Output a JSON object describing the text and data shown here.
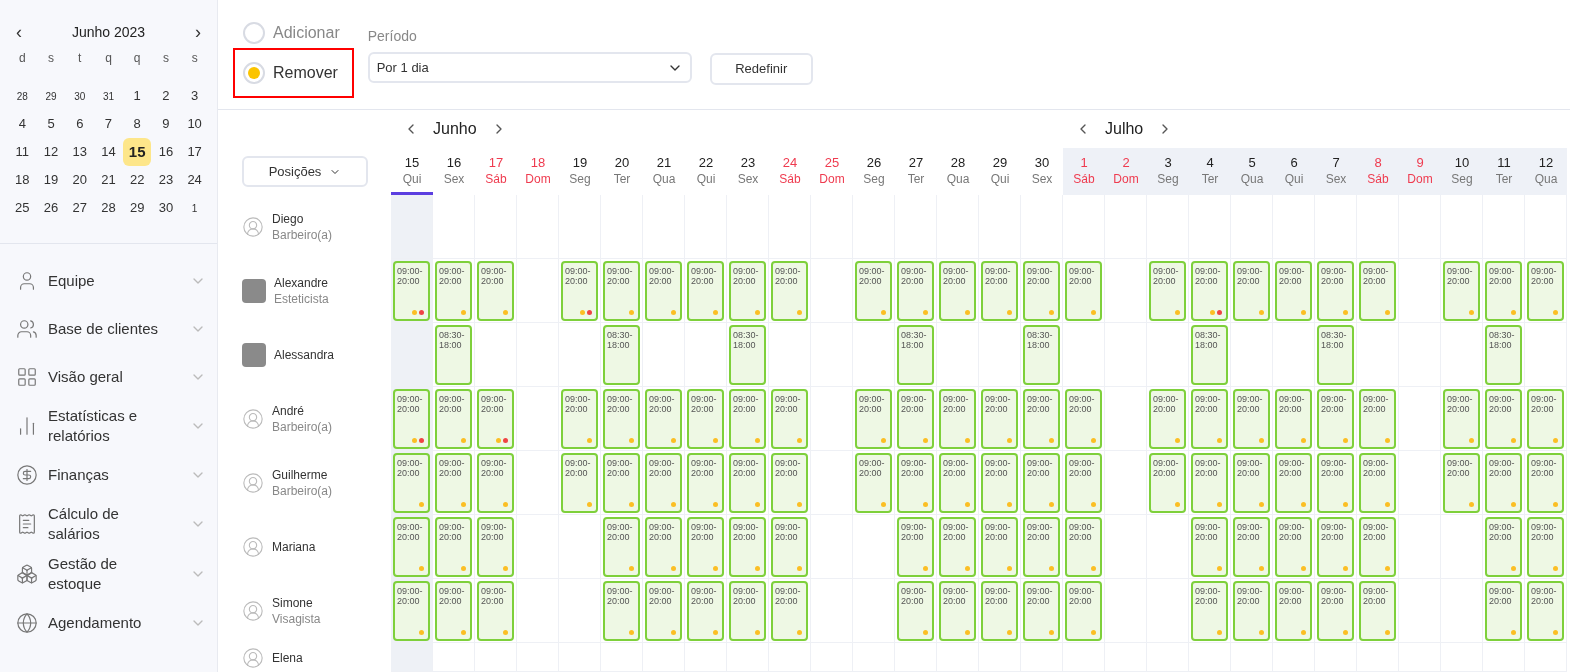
{
  "calendar": {
    "title": "Junho 2023",
    "prev": "‹",
    "next": "›",
    "weekdays": [
      "d",
      "s",
      "t",
      "q",
      "q",
      "s",
      "s"
    ],
    "days": [
      {
        "label": "28",
        "outside": true,
        "selected": false
      },
      {
        "label": "29",
        "outside": true,
        "selected": false
      },
      {
        "label": "30",
        "outside": true,
        "selected": false
      },
      {
        "label": "31",
        "outside": true,
        "selected": false
      },
      {
        "label": "1",
        "outside": false,
        "selected": false
      },
      {
        "label": "2",
        "outside": false,
        "selected": false
      },
      {
        "label": "3",
        "outside": false,
        "selected": false
      },
      {
        "label": "4",
        "outside": false,
        "selected": false
      },
      {
        "label": "5",
        "outside": false,
        "selected": false
      },
      {
        "label": "6",
        "outside": false,
        "selected": false
      },
      {
        "label": "7",
        "outside": false,
        "selected": false
      },
      {
        "label": "8",
        "outside": false,
        "selected": false
      },
      {
        "label": "9",
        "outside": false,
        "selected": false
      },
      {
        "label": "10",
        "outside": false,
        "selected": false
      },
      {
        "label": "11",
        "outside": false,
        "selected": false
      },
      {
        "label": "12",
        "outside": false,
        "selected": false
      },
      {
        "label": "13",
        "outside": false,
        "selected": false
      },
      {
        "label": "14",
        "outside": false,
        "selected": false
      },
      {
        "label": "15",
        "outside": false,
        "selected": true
      },
      {
        "label": "16",
        "outside": false,
        "selected": false
      },
      {
        "label": "17",
        "outside": false,
        "selected": false
      },
      {
        "label": "18",
        "outside": false,
        "selected": false
      },
      {
        "label": "19",
        "outside": false,
        "selected": false
      },
      {
        "label": "20",
        "outside": false,
        "selected": false
      },
      {
        "label": "21",
        "outside": false,
        "selected": false
      },
      {
        "label": "22",
        "outside": false,
        "selected": false
      },
      {
        "label": "23",
        "outside": false,
        "selected": false
      },
      {
        "label": "24",
        "outside": false,
        "selected": false
      },
      {
        "label": "25",
        "outside": false,
        "selected": false
      },
      {
        "label": "26",
        "outside": false,
        "selected": false
      },
      {
        "label": "27",
        "outside": false,
        "selected": false
      },
      {
        "label": "28",
        "outside": false,
        "selected": false
      },
      {
        "label": "29",
        "outside": false,
        "selected": false
      },
      {
        "label": "30",
        "outside": false,
        "selected": false
      },
      {
        "label": "1",
        "outside": true,
        "selected": false
      }
    ]
  },
  "nav": [
    {
      "label": "Equipe"
    },
    {
      "label": "Base de clientes"
    },
    {
      "label": "Visão geral"
    },
    {
      "label": "Estatísticas e relatórios"
    },
    {
      "label": "Finanças"
    },
    {
      "label": "Cálculo de salários"
    },
    {
      "label": "Gestão de estoque"
    },
    {
      "label": "Agendamento"
    }
  ],
  "mode": [
    {
      "label": "Adicionar",
      "selected": false,
      "highlighted": false
    },
    {
      "label": "Remover",
      "selected": true,
      "highlighted": true
    }
  ],
  "period": {
    "label": "Período",
    "value": "Por 1 dia"
  },
  "reset_button": "Redefinir",
  "positions_button": "Posições",
  "months": [
    {
      "name": "Junho",
      "shaded": false,
      "days": [
        {
          "date": "15",
          "weekday": "Qui",
          "weekend": false,
          "selected": true
        },
        {
          "date": "16",
          "weekday": "Sex",
          "weekend": false,
          "selected": false
        },
        {
          "date": "17",
          "weekday": "Sáb",
          "weekend": true,
          "selected": false
        },
        {
          "date": "18",
          "weekday": "Dom",
          "weekend": true,
          "selected": false
        },
        {
          "date": "19",
          "weekday": "Seg",
          "weekend": false,
          "selected": false
        },
        {
          "date": "20",
          "weekday": "Ter",
          "weekend": false,
          "selected": false
        },
        {
          "date": "21",
          "weekday": "Qua",
          "weekend": false,
          "selected": false
        },
        {
          "date": "22",
          "weekday": "Qui",
          "weekend": false,
          "selected": false
        },
        {
          "date": "23",
          "weekday": "Sex",
          "weekend": false,
          "selected": false
        },
        {
          "date": "24",
          "weekday": "Sáb",
          "weekend": true,
          "selected": false
        },
        {
          "date": "25",
          "weekday": "Dom",
          "weekend": true,
          "selected": false
        },
        {
          "date": "26",
          "weekday": "Seg",
          "weekend": false,
          "selected": false
        },
        {
          "date": "27",
          "weekday": "Ter",
          "weekend": false,
          "selected": false
        },
        {
          "date": "28",
          "weekday": "Qua",
          "weekend": false,
          "selected": false
        },
        {
          "date": "29",
          "weekday": "Qui",
          "weekend": false,
          "selected": false
        },
        {
          "date": "30",
          "weekday": "Sex",
          "weekend": false,
          "selected": false
        }
      ]
    },
    {
      "name": "Julho",
      "shaded": true,
      "days": [
        {
          "date": "1",
          "weekday": "Sáb",
          "weekend": true,
          "selected": false
        },
        {
          "date": "2",
          "weekday": "Dom",
          "weekend": true,
          "selected": false
        },
        {
          "date": "3",
          "weekday": "Seg",
          "weekend": false,
          "selected": false
        },
        {
          "date": "4",
          "weekday": "Ter",
          "weekend": false,
          "selected": false
        },
        {
          "date": "5",
          "weekday": "Qua",
          "weekend": false,
          "selected": false
        },
        {
          "date": "6",
          "weekday": "Qui",
          "weekend": false,
          "selected": false
        },
        {
          "date": "7",
          "weekday": "Sex",
          "weekend": false,
          "selected": false
        },
        {
          "date": "8",
          "weekday": "Sáb",
          "weekend": true,
          "selected": false
        },
        {
          "date": "9",
          "weekday": "Dom",
          "weekend": true,
          "selected": false
        },
        {
          "date": "10",
          "weekday": "Seg",
          "weekend": false,
          "selected": false
        },
        {
          "date": "11",
          "weekday": "Ter",
          "weekend": false,
          "selected": false
        },
        {
          "date": "12",
          "weekday": "Qua",
          "weekend": false,
          "selected": false
        }
      ]
    }
  ],
  "staff": [
    {
      "name": "Diego",
      "role": "Barbeiro(a)",
      "kind": "generic",
      "cells": [
        {
          "kind": "empty"
        },
        {
          "kind": "empty"
        },
        {
          "kind": "empty"
        },
        {
          "kind": "empty"
        },
        {
          "kind": "empty"
        },
        {
          "kind": "empty"
        },
        {
          "kind": "empty"
        },
        {
          "kind": "empty"
        },
        {
          "kind": "empty"
        },
        {
          "kind": "empty"
        },
        {
          "kind": "empty"
        },
        {
          "kind": "empty"
        },
        {
          "kind": "empty"
        },
        {
          "kind": "empty"
        },
        {
          "kind": "empty"
        },
        {
          "kind": "empty"
        },
        {
          "kind": "empty"
        },
        {
          "kind": "empty"
        },
        {
          "kind": "empty"
        },
        {
          "kind": "empty"
        },
        {
          "kind": "empty"
        },
        {
          "kind": "empty"
        },
        {
          "kind": "empty"
        },
        {
          "kind": "empty"
        },
        {
          "kind": "empty"
        },
        {
          "kind": "empty"
        },
        {
          "kind": "empty"
        },
        {
          "kind": "empty"
        }
      ]
    },
    {
      "name": "Alexandre",
      "role": "Esteticista",
      "kind": "photo",
      "cells": [
        {
          "kind": "shift",
          "time": "09:00-20:00",
          "dots": [
            {
              "color": "#fbbf24"
            },
            {
              "color": "#ef4444"
            }
          ]
        },
        {
          "kind": "shift",
          "time": "09:00-20:00",
          "dots": [
            {
              "color": "#fbbf24"
            }
          ]
        },
        {
          "kind": "shift",
          "time": "09:00-20:00",
          "dots": [
            {
              "color": "#fbbf24"
            }
          ]
        },
        {
          "kind": "empty"
        },
        {
          "kind": "shift",
          "time": "09:00-20:00",
          "dots": [
            {
              "color": "#fbbf24"
            },
            {
              "color": "#ef4444"
            }
          ]
        },
        {
          "kind": "shift",
          "time": "09:00-20:00",
          "dots": [
            {
              "color": "#fbbf24"
            }
          ]
        },
        {
          "kind": "shift",
          "time": "09:00-20:00",
          "dots": [
            {
              "color": "#fbbf24"
            }
          ]
        },
        {
          "kind": "shift",
          "time": "09:00-20:00",
          "dots": [
            {
              "color": "#fbbf24"
            }
          ]
        },
        {
          "kind": "shift",
          "time": "09:00-20:00",
          "dots": [
            {
              "color": "#fbbf24"
            }
          ]
        },
        {
          "kind": "shift",
          "time": "09:00-20:00",
          "dots": [
            {
              "color": "#fbbf24"
            }
          ]
        },
        {
          "kind": "empty"
        },
        {
          "kind": "shift",
          "time": "09:00-20:00",
          "dots": [
            {
              "color": "#fbbf24"
            }
          ]
        },
        {
          "kind": "shift",
          "time": "09:00-20:00",
          "dots": [
            {
              "color": "#fbbf24"
            }
          ]
        },
        {
          "kind": "shift",
          "time": "09:00-20:00",
          "dots": [
            {
              "color": "#fbbf24"
            }
          ]
        },
        {
          "kind": "shift",
          "time": "09:00-20:00",
          "dots": [
            {
              "color": "#fbbf24"
            }
          ]
        },
        {
          "kind": "shift",
          "time": "09:00-20:00",
          "dots": [
            {
              "color": "#fbbf24"
            }
          ]
        },
        {
          "kind": "shift",
          "time": "09:00-20:00",
          "dots": [
            {
              "color": "#fbbf24"
            }
          ]
        },
        {
          "kind": "empty"
        },
        {
          "kind": "shift",
          "time": "09:00-20:00",
          "dots": [
            {
              "color": "#fbbf24"
            }
          ]
        },
        {
          "kind": "shift",
          "time": "09:00-20:00",
          "dots": [
            {
              "color": "#fbbf24"
            },
            {
              "color": "#ef4444"
            }
          ]
        },
        {
          "kind": "shift",
          "time": "09:00-20:00",
          "dots": [
            {
              "color": "#fbbf24"
            }
          ]
        },
        {
          "kind": "shift",
          "time": "09:00-20:00",
          "dots": [
            {
              "color": "#fbbf24"
            }
          ]
        },
        {
          "kind": "shift",
          "time": "09:00-20:00",
          "dots": [
            {
              "color": "#fbbf24"
            }
          ]
        },
        {
          "kind": "shift",
          "time": "09:00-20:00",
          "dots": [
            {
              "color": "#fbbf24"
            }
          ]
        },
        {
          "kind": "empty"
        },
        {
          "kind": "shift",
          "time": "09:00-20:00",
          "dots": [
            {
              "color": "#fbbf24"
            }
          ]
        },
        {
          "kind": "shift",
          "time": "09:00-20:00",
          "dots": [
            {
              "color": "#fbbf24"
            }
          ]
        },
        {
          "kind": "shift",
          "time": "09:00-20:00",
          "dots": [
            {
              "color": "#fbbf24"
            }
          ]
        }
      ]
    },
    {
      "name": "Alessandra",
      "kind": "photo",
      "cells": [
        {
          "kind": "empty"
        },
        {
          "kind": "shift",
          "time": "08:30-18:00"
        },
        {
          "kind": "empty"
        },
        {
          "kind": "empty"
        },
        {
          "kind": "empty"
        },
        {
          "kind": "shift",
          "time": "08:30-18:00"
        },
        {
          "kind": "empty"
        },
        {
          "kind": "empty"
        },
        {
          "kind": "shift",
          "time": "08:30-18:00"
        },
        {
          "kind": "empty"
        },
        {
          "kind": "empty"
        },
        {
          "kind": "empty"
        },
        {
          "kind": "shift",
          "time": "08:30-18:00"
        },
        {
          "kind": "empty"
        },
        {
          "kind": "empty"
        },
        {
          "kind": "shift",
          "time": "08:30-18:00"
        },
        {
          "kind": "empty"
        },
        {
          "kind": "empty"
        },
        {
          "kind": "empty"
        },
        {
          "kind": "shift",
          "time": "08:30-18:00"
        },
        {
          "kind": "empty"
        },
        {
          "kind": "empty"
        },
        {
          "kind": "shift",
          "time": "08:30-18:00"
        },
        {
          "kind": "empty"
        },
        {
          "kind": "empty"
        },
        {
          "kind": "empty"
        },
        {
          "kind": "shift",
          "time": "08:30-18:00"
        },
        {
          "kind": "empty"
        }
      ]
    },
    {
      "name": "André",
      "role": "Barbeiro(a)",
      "kind": "generic",
      "cells": [
        {
          "kind": "shift",
          "time": "09:00-20:00",
          "dots": [
            {
              "color": "#fbbf24"
            },
            {
              "color": "#ef4444"
            }
          ]
        },
        {
          "kind": "shift",
          "time": "09:00-20:00",
          "dots": [
            {
              "color": "#fbbf24"
            }
          ]
        },
        {
          "kind": "shift",
          "time": "09:00-20:00",
          "dots": [
            {
              "color": "#fbbf24"
            },
            {
              "color": "#ef4444"
            }
          ]
        },
        {
          "kind": "empty"
        },
        {
          "kind": "shift",
          "time": "09:00-20:00",
          "dots": [
            {
              "color": "#fbbf24"
            }
          ]
        },
        {
          "kind": "shift",
          "time": "09:00-20:00",
          "dots": [
            {
              "color": "#fbbf24"
            }
          ]
        },
        {
          "kind": "shift",
          "time": "09:00-20:00",
          "dots": [
            {
              "color": "#fbbf24"
            }
          ]
        },
        {
          "kind": "shift",
          "time": "09:00-20:00",
          "dots": [
            {
              "color": "#fbbf24"
            }
          ]
        },
        {
          "kind": "shift",
          "time": "09:00-20:00",
          "dots": [
            {
              "color": "#fbbf24"
            }
          ]
        },
        {
          "kind": "shift",
          "time": "09:00-20:00",
          "dots": [
            {
              "color": "#fbbf24"
            }
          ]
        },
        {
          "kind": "empty"
        },
        {
          "kind": "shift",
          "time": "09:00-20:00",
          "dots": [
            {
              "color": "#fbbf24"
            }
          ]
        },
        {
          "kind": "shift",
          "time": "09:00-20:00",
          "dots": [
            {
              "color": "#fbbf24"
            }
          ]
        },
        {
          "kind": "shift",
          "time": "09:00-20:00",
          "dots": [
            {
              "color": "#fbbf24"
            }
          ]
        },
        {
          "kind": "shift",
          "time": "09:00-20:00",
          "dots": [
            {
              "color": "#fbbf24"
            }
          ]
        },
        {
          "kind": "shift",
          "time": "09:00-20:00",
          "dots": [
            {
              "color": "#fbbf24"
            }
          ]
        },
        {
          "kind": "shift",
          "time": "09:00-20:00",
          "dots": [
            {
              "color": "#fbbf24"
            }
          ]
        },
        {
          "kind": "empty"
        },
        {
          "kind": "shift",
          "time": "09:00-20:00",
          "dots": [
            {
              "color": "#fbbf24"
            }
          ]
        },
        {
          "kind": "shift",
          "time": "09:00-20:00",
          "dots": [
            {
              "color": "#fbbf24"
            }
          ]
        },
        {
          "kind": "shift",
          "time": "09:00-20:00",
          "dots": [
            {
              "color": "#fbbf24"
            }
          ]
        },
        {
          "kind": "shift",
          "time": "09:00-20:00",
          "dots": [
            {
              "color": "#fbbf24"
            }
          ]
        },
        {
          "kind": "shift",
          "time": "09:00-20:00",
          "dots": [
            {
              "color": "#fbbf24"
            }
          ]
        },
        {
          "kind": "shift",
          "time": "09:00-20:00",
          "dots": [
            {
              "color": "#fbbf24"
            }
          ]
        },
        {
          "kind": "empty"
        },
        {
          "kind": "shift",
          "time": "09:00-20:00",
          "dots": [
            {
              "color": "#fbbf24"
            }
          ]
        },
        {
          "kind": "shift",
          "time": "09:00-20:00",
          "dots": [
            {
              "color": "#fbbf24"
            }
          ]
        },
        {
          "kind": "shift",
          "time": "09:00-20:00",
          "dots": [
            {
              "color": "#fbbf24"
            }
          ]
        }
      ]
    },
    {
      "name": "Guilherme",
      "role": "Barbeiro(a)",
      "kind": "generic",
      "cells": [
        {
          "kind": "shift",
          "time": "09:00-20:00",
          "dots": [
            {
              "color": "#fbbf24"
            }
          ]
        },
        {
          "kind": "shift",
          "time": "09:00-20:00",
          "dots": [
            {
              "color": "#fbbf24"
            }
          ]
        },
        {
          "kind": "shift",
          "time": "09:00-20:00",
          "dots": [
            {
              "color": "#fbbf24"
            }
          ]
        },
        {
          "kind": "empty"
        },
        {
          "kind": "shift",
          "time": "09:00-20:00",
          "dots": [
            {
              "color": "#fbbf24"
            }
          ]
        },
        {
          "kind": "shift",
          "time": "09:00-20:00",
          "dots": [
            {
              "color": "#fbbf24"
            }
          ]
        },
        {
          "kind": "shift",
          "time": "09:00-20:00",
          "dots": [
            {
              "color": "#fbbf24"
            }
          ]
        },
        {
          "kind": "shift",
          "time": "09:00-20:00",
          "dots": [
            {
              "color": "#fbbf24"
            }
          ]
        },
        {
          "kind": "shift",
          "time": "09:00-20:00",
          "dots": [
            {
              "color": "#fbbf24"
            }
          ]
        },
        {
          "kind": "shift",
          "time": "09:00-20:00",
          "dots": [
            {
              "color": "#fbbf24"
            }
          ]
        },
        {
          "kind": "empty"
        },
        {
          "kind": "shift",
          "time": "09:00-20:00",
          "dots": [
            {
              "color": "#fbbf24"
            }
          ]
        },
        {
          "kind": "shift",
          "time": "09:00-20:00",
          "dots": [
            {
              "color": "#fbbf24"
            }
          ]
        },
        {
          "kind": "shift",
          "time": "09:00-20:00",
          "dots": [
            {
              "color": "#fbbf24"
            }
          ]
        },
        {
          "kind": "shift",
          "time": "09:00-20:00",
          "dots": [
            {
              "color": "#fbbf24"
            }
          ]
        },
        {
          "kind": "shift",
          "time": "09:00-20:00",
          "dots": [
            {
              "color": "#fbbf24"
            }
          ]
        },
        {
          "kind": "shift",
          "time": "09:00-20:00",
          "dots": [
            {
              "color": "#fbbf24"
            }
          ]
        },
        {
          "kind": "empty"
        },
        {
          "kind": "shift",
          "time": "09:00-20:00",
          "dots": [
            {
              "color": "#fbbf24"
            }
          ]
        },
        {
          "kind": "shift",
          "time": "09:00-20:00",
          "dots": [
            {
              "color": "#fbbf24"
            }
          ]
        },
        {
          "kind": "shift",
          "time": "09:00-20:00",
          "dots": [
            {
              "color": "#fbbf24"
            }
          ]
        },
        {
          "kind": "shift",
          "time": "09:00-20:00",
          "dots": [
            {
              "color": "#fbbf24"
            }
          ]
        },
        {
          "kind": "shift",
          "time": "09:00-20:00",
          "dots": [
            {
              "color": "#fbbf24"
            }
          ]
        },
        {
          "kind": "shift",
          "time": "09:00-20:00",
          "dots": [
            {
              "color": "#fbbf24"
            }
          ]
        },
        {
          "kind": "empty"
        },
        {
          "kind": "shift",
          "time": "09:00-20:00",
          "dots": [
            {
              "color": "#fbbf24"
            }
          ]
        },
        {
          "kind": "shift",
          "time": "09:00-20:00",
          "dots": [
            {
              "color": "#fbbf24"
            }
          ]
        },
        {
          "kind": "shift",
          "time": "09:00-20:00",
          "dots": [
            {
              "color": "#fbbf24"
            }
          ]
        }
      ]
    },
    {
      "name": "Mariana",
      "kind": "generic",
      "cells": [
        {
          "kind": "shift",
          "time": "09:00-20:00",
          "dots": [
            {
              "color": "#fbbf24"
            }
          ]
        },
        {
          "kind": "shift",
          "time": "09:00-20:00",
          "dots": [
            {
              "color": "#fbbf24"
            }
          ]
        },
        {
          "kind": "shift",
          "time": "09:00-20:00",
          "dots": [
            {
              "color": "#fbbf24"
            }
          ]
        },
        {
          "kind": "empty"
        },
        {
          "kind": "empty"
        },
        {
          "kind": "shift",
          "time": "09:00-20:00",
          "dots": [
            {
              "color": "#fbbf24"
            }
          ]
        },
        {
          "kind": "shift",
          "time": "09:00-20:00",
          "dots": [
            {
              "color": "#fbbf24"
            }
          ]
        },
        {
          "kind": "shift",
          "time": "09:00-20:00",
          "dots": [
            {
              "color": "#fbbf24"
            }
          ]
        },
        {
          "kind": "shift",
          "time": "09:00-20:00",
          "dots": [
            {
              "color": "#fbbf24"
            }
          ]
        },
        {
          "kind": "shift",
          "time": "09:00-20:00",
          "dots": [
            {
              "color": "#fbbf24"
            }
          ]
        },
        {
          "kind": "empty"
        },
        {
          "kind": "empty"
        },
        {
          "kind": "shift",
          "time": "09:00-20:00",
          "dots": [
            {
              "color": "#fbbf24"
            }
          ]
        },
        {
          "kind": "shift",
          "time": "09:00-20:00",
          "dots": [
            {
              "color": "#fbbf24"
            }
          ]
        },
        {
          "kind": "shift",
          "time": "09:00-20:00",
          "dots": [
            {
              "color": "#fbbf24"
            }
          ]
        },
        {
          "kind": "shift",
          "time": "09:00-20:00",
          "dots": [
            {
              "color": "#fbbf24"
            }
          ]
        },
        {
          "kind": "shift",
          "time": "09:00-20:00",
          "dots": [
            {
              "color": "#fbbf24"
            }
          ]
        },
        {
          "kind": "empty"
        },
        {
          "kind": "empty"
        },
        {
          "kind": "shift",
          "time": "09:00-20:00",
          "dots": [
            {
              "color": "#fbbf24"
            }
          ]
        },
        {
          "kind": "shift",
          "time": "09:00-20:00",
          "dots": [
            {
              "color": "#fbbf24"
            }
          ]
        },
        {
          "kind": "shift",
          "time": "09:00-20:00",
          "dots": [
            {
              "color": "#fbbf24"
            }
          ]
        },
        {
          "kind": "shift",
          "time": "09:00-20:00",
          "dots": [
            {
              "color": "#fbbf24"
            }
          ]
        },
        {
          "kind": "shift",
          "time": "09:00-20:00",
          "dots": [
            {
              "color": "#fbbf24"
            }
          ]
        },
        {
          "kind": "empty"
        },
        {
          "kind": "empty"
        },
        {
          "kind": "shift",
          "time": "09:00-20:00",
          "dots": [
            {
              "color": "#fbbf24"
            }
          ]
        },
        {
          "kind": "shift",
          "time": "09:00-20:00",
          "dots": [
            {
              "color": "#fbbf24"
            }
          ]
        }
      ]
    },
    {
      "name": "Simone",
      "role": "Visagista",
      "kind": "generic",
      "cells": [
        {
          "kind": "shift",
          "time": "09:00-20:00",
          "dots": [
            {
              "color": "#fbbf24"
            }
          ]
        },
        {
          "kind": "shift",
          "time": "09:00-20:00",
          "dots": [
            {
              "color": "#fbbf24"
            }
          ]
        },
        {
          "kind": "shift",
          "time": "09:00-20:00",
          "dots": [
            {
              "color": "#fbbf24"
            }
          ]
        },
        {
          "kind": "empty"
        },
        {
          "kind": "empty"
        },
        {
          "kind": "shift",
          "time": "09:00-20:00",
          "dots": [
            {
              "color": "#fbbf24"
            }
          ]
        },
        {
          "kind": "shift",
          "time": "09:00-20:00",
          "dots": [
            {
              "color": "#fbbf24"
            }
          ]
        },
        {
          "kind": "shift",
          "time": "09:00-20:00",
          "dots": [
            {
              "color": "#fbbf24"
            }
          ]
        },
        {
          "kind": "shift",
          "time": "09:00-20:00",
          "dots": [
            {
              "color": "#fbbf24"
            }
          ]
        },
        {
          "kind": "shift",
          "time": "09:00-20:00",
          "dots": [
            {
              "color": "#fbbf24"
            }
          ]
        },
        {
          "kind": "empty"
        },
        {
          "kind": "empty"
        },
        {
          "kind": "shift",
          "time": "09:00-20:00",
          "dots": [
            {
              "color": "#fbbf24"
            }
          ]
        },
        {
          "kind": "shift",
          "time": "09:00-20:00",
          "dots": [
            {
              "color": "#fbbf24"
            }
          ]
        },
        {
          "kind": "shift",
          "time": "09:00-20:00",
          "dots": [
            {
              "color": "#fbbf24"
            }
          ]
        },
        {
          "kind": "shift",
          "time": "09:00-20:00",
          "dots": [
            {
              "color": "#fbbf24"
            }
          ]
        },
        {
          "kind": "shift",
          "time": "09:00-20:00",
          "dots": [
            {
              "color": "#fbbf24"
            }
          ]
        },
        {
          "kind": "empty"
        },
        {
          "kind": "empty"
        },
        {
          "kind": "shift",
          "time": "09:00-20:00",
          "dots": [
            {
              "color": "#fbbf24"
            }
          ]
        },
        {
          "kind": "shift",
          "time": "09:00-20:00",
          "dots": [
            {
              "color": "#fbbf24"
            }
          ]
        },
        {
          "kind": "shift",
          "time": "09:00-20:00",
          "dots": [
            {
              "color": "#fbbf24"
            }
          ]
        },
        {
          "kind": "shift",
          "time": "09:00-20:00",
          "dots": [
            {
              "color": "#fbbf24"
            }
          ]
        },
        {
          "kind": "shift",
          "time": "09:00-20:00",
          "dots": [
            {
              "color": "#fbbf24"
            }
          ]
        },
        {
          "kind": "empty"
        },
        {
          "kind": "empty"
        },
        {
          "kind": "shift",
          "time": "09:00-20:00",
          "dots": [
            {
              "color": "#fbbf24"
            }
          ]
        },
        {
          "kind": "shift",
          "time": "09:00-20:00",
          "dots": [
            {
              "color": "#fbbf24"
            }
          ]
        }
      ]
    },
    {
      "name": "Elena",
      "kind": "generic",
      "cells": [
        {
          "kind": "empty"
        },
        {
          "kind": "empty"
        },
        {
          "kind": "empty"
        },
        {
          "kind": "empty"
        },
        {
          "kind": "empty"
        },
        {
          "kind": "empty"
        },
        {
          "kind": "empty"
        },
        {
          "kind": "empty"
        },
        {
          "kind": "empty"
        },
        {
          "kind": "empty"
        },
        {
          "kind": "empty"
        },
        {
          "kind": "empty"
        },
        {
          "kind": "empty"
        },
        {
          "kind": "empty"
        },
        {
          "kind": "empty"
        },
        {
          "kind": "empty"
        },
        {
          "kind": "empty"
        },
        {
          "kind": "empty"
        },
        {
          "kind": "empty"
        },
        {
          "kind": "empty"
        },
        {
          "kind": "empty"
        },
        {
          "kind": "empty"
        },
        {
          "kind": "empty"
        },
        {
          "kind": "empty"
        },
        {
          "kind": "empty"
        },
        {
          "kind": "empty"
        },
        {
          "kind": "empty"
        },
        {
          "kind": "empty"
        }
      ]
    }
  ]
}
